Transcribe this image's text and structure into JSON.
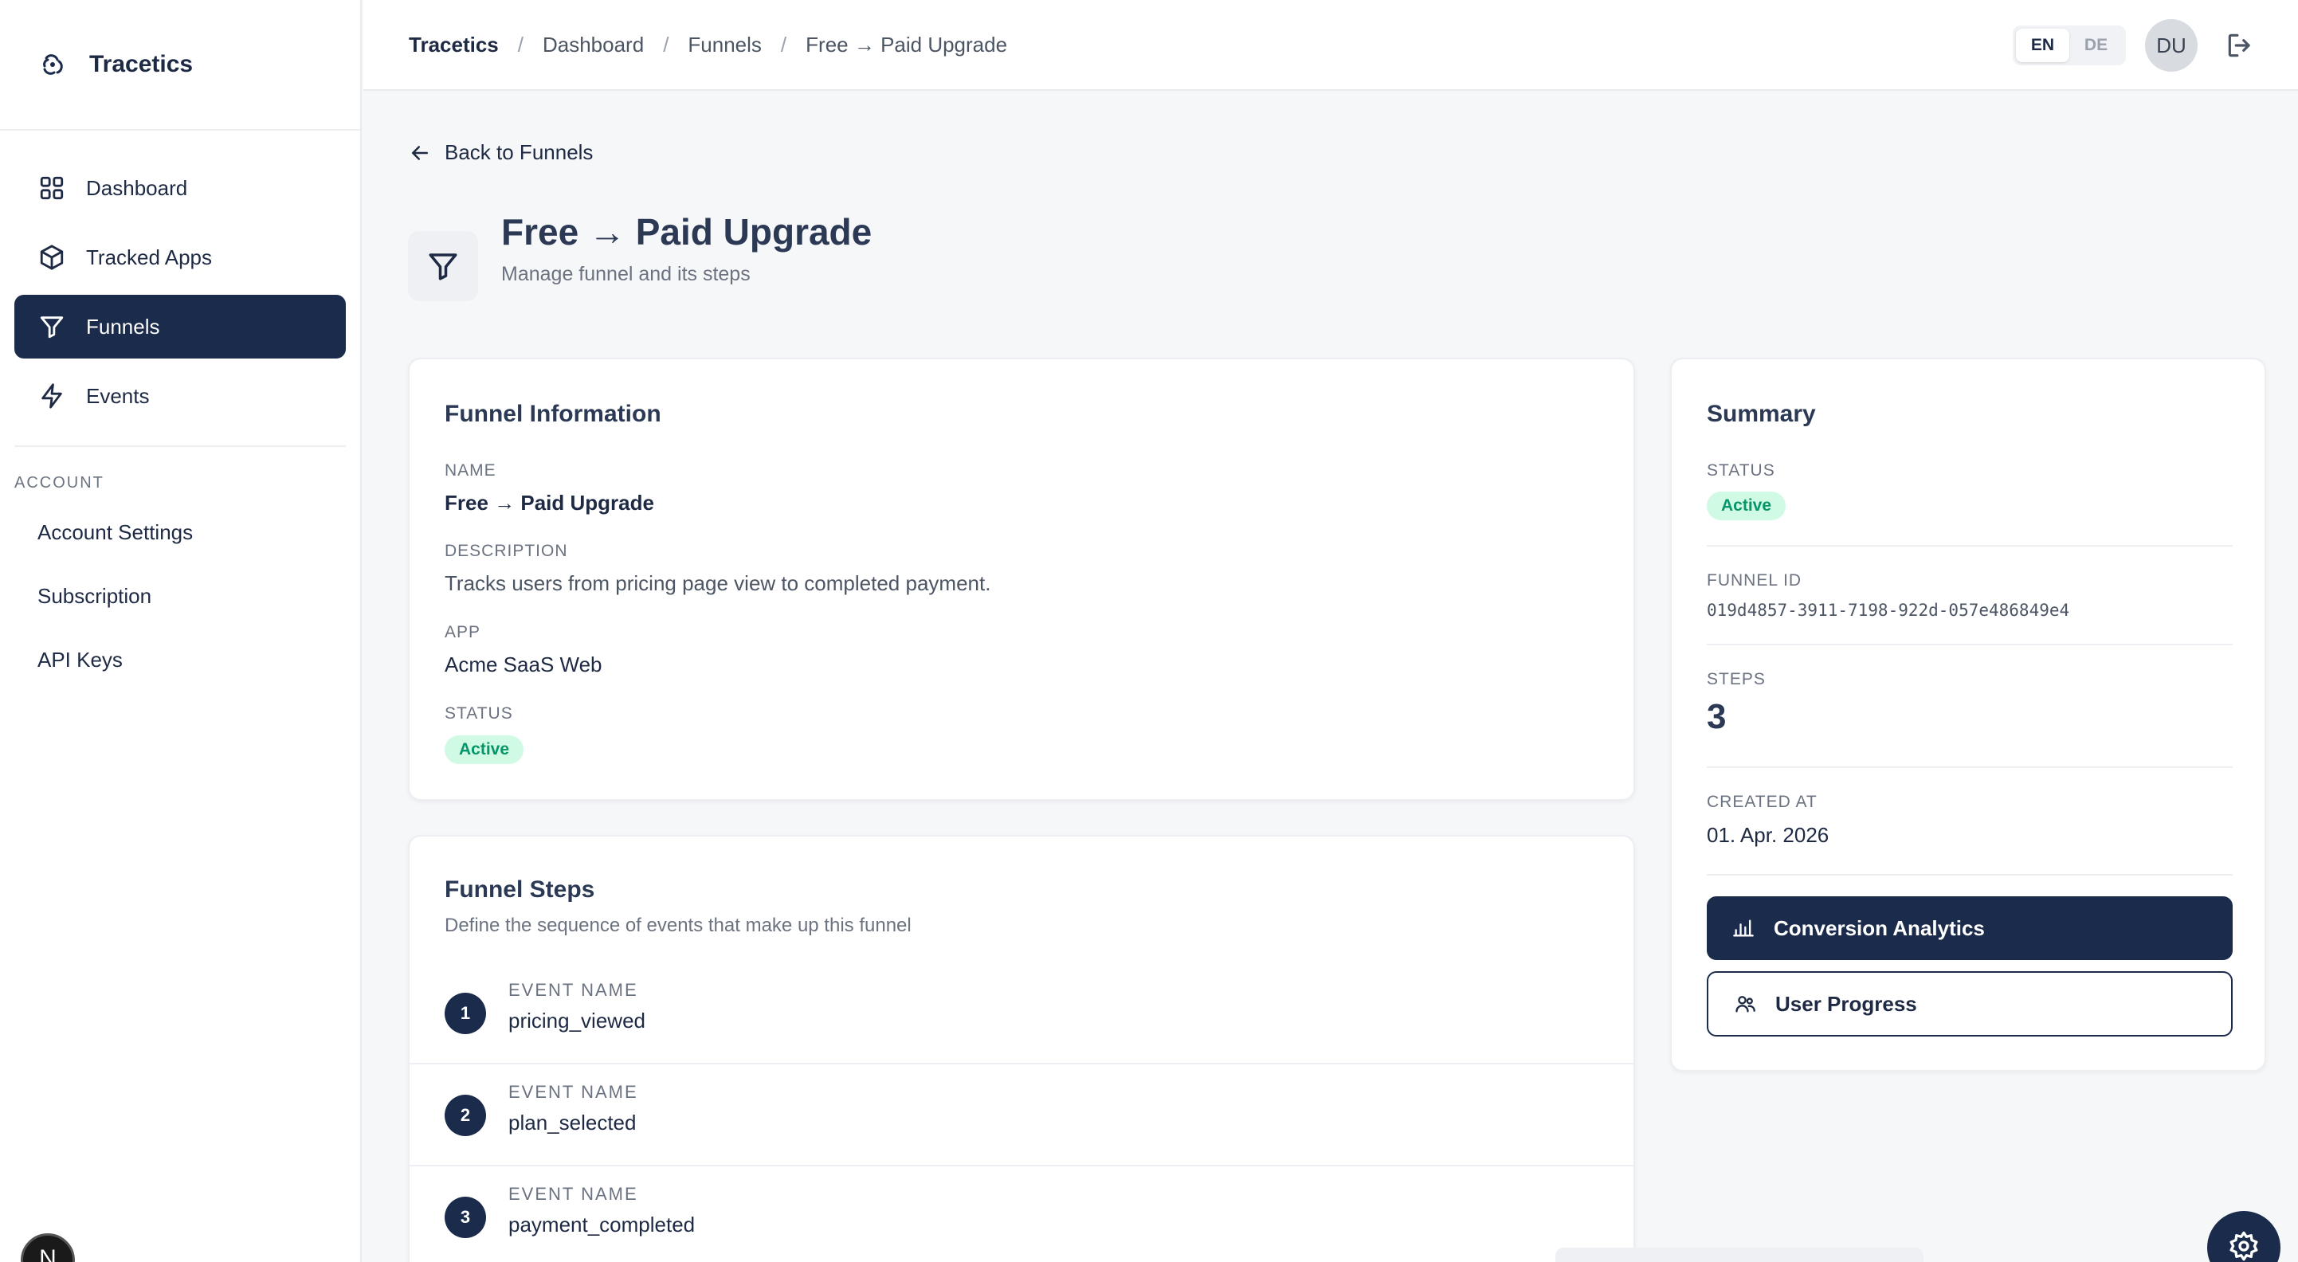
{
  "app": {
    "name": "Tracetics"
  },
  "sidebar": {
    "nav": [
      {
        "label": "Dashboard",
        "icon": "grid-icon"
      },
      {
        "label": "Tracked Apps",
        "icon": "package-icon"
      },
      {
        "label": "Funnels",
        "icon": "funnel-icon",
        "active": true
      },
      {
        "label": "Events",
        "icon": "lightning-icon"
      }
    ],
    "account_label": "ACCOUNT",
    "account_items": [
      {
        "label": "Account Settings"
      },
      {
        "label": "Subscription"
      },
      {
        "label": "API Keys"
      }
    ],
    "dev_badge": "N"
  },
  "topbar": {
    "breadcrumb": [
      "Tracetics",
      "Dashboard",
      "Funnels",
      "Free → Paid Upgrade"
    ],
    "separator": "/",
    "lang": {
      "en": "EN",
      "de": "DE",
      "active": "EN"
    },
    "avatar_initials": "DU"
  },
  "page": {
    "back_label": "Back to Funnels",
    "title": "Free → Paid Upgrade",
    "subtitle": "Manage funnel and its steps"
  },
  "info": {
    "title": "Funnel Information",
    "name_label": "NAME",
    "name_value": "Free → Paid Upgrade",
    "desc_label": "DESCRIPTION",
    "desc_value": "Tracks users from pricing page view to completed payment.",
    "app_label": "APP",
    "app_value": "Acme SaaS Web",
    "status_label": "STATUS",
    "status_value": "Active"
  },
  "steps": {
    "title": "Funnel Steps",
    "subtitle": "Define the sequence of events that make up this funnel",
    "items": [
      {
        "num": "1",
        "label": "EVENT NAME",
        "value": "pricing_viewed"
      },
      {
        "num": "2",
        "label": "EVENT NAME",
        "value": "plan_selected"
      },
      {
        "num": "3",
        "label": "EVENT NAME",
        "value": "payment_completed"
      }
    ]
  },
  "summary": {
    "title": "Summary",
    "status_label": "STATUS",
    "status_value": "Active",
    "id_label": "FUNNEL ID",
    "id_value": "019d4857-3911-7198-922d-057e486849e4",
    "steps_label": "STEPS",
    "steps_value": "3",
    "created_label": "CREATED AT",
    "created_value": "01. Apr. 2026",
    "btn_analytics": "Conversion Analytics",
    "btn_progress": "User Progress"
  },
  "colors": {
    "primary": "#1b2b4b",
    "success_bg": "#d1fae5",
    "success_text": "#059669"
  }
}
